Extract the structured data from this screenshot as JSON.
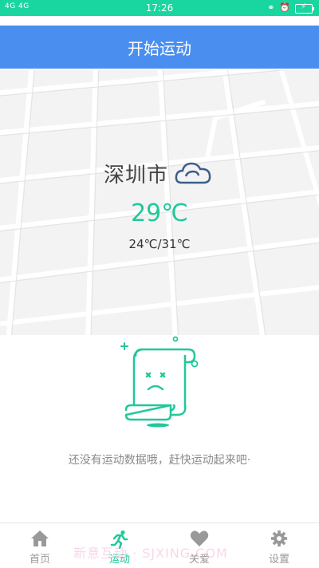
{
  "status_bar": {
    "signal_text": "4G 4G",
    "time": "17:26",
    "icons": [
      "lock-icon",
      "alarm-icon",
      "battery-charging-icon"
    ]
  },
  "header": {
    "title": "开始运动"
  },
  "weather": {
    "city": "深圳市",
    "condition_icon": "cloudy-icon",
    "temperature": "29℃",
    "range": "24℃/31℃"
  },
  "empty_state": {
    "icon": "sad-scroll-icon",
    "message": "还没有运动数据哦，赶快运动起来吧·"
  },
  "tab_bar": {
    "tabs": [
      {
        "label": "首页",
        "icon": "home-icon",
        "active": false
      },
      {
        "label": "运动",
        "icon": "running-icon",
        "active": true
      },
      {
        "label": "关爱",
        "icon": "heart-icon",
        "active": false
      },
      {
        "label": "设置",
        "icon": "gear-icon",
        "active": false
      }
    ]
  },
  "watermark": "新意互动 · SJXING.COM",
  "colors": {
    "status_bar": "#19d6a0",
    "header": "#4a8ef0",
    "accent": "#21c89a",
    "inactive": "#999999"
  }
}
